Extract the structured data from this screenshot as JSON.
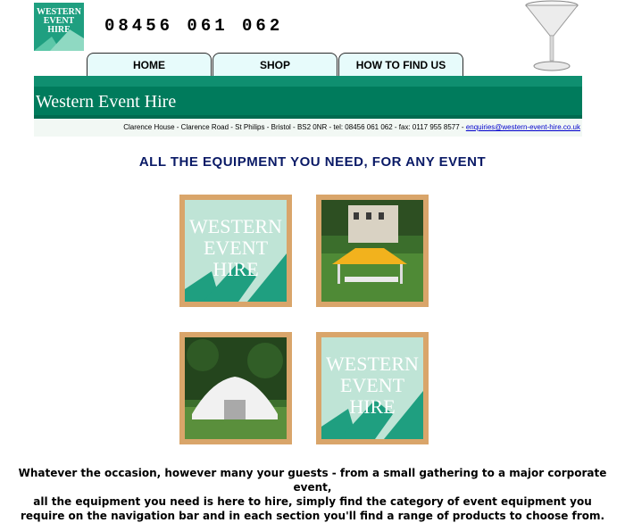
{
  "header": {
    "logo_text": [
      "WESTERN",
      "EVENT",
      "HIRE"
    ],
    "phone": "08456 061 062"
  },
  "nav": {
    "tabs": [
      {
        "label": "HOME"
      },
      {
        "label": "SHOP"
      },
      {
        "label": "HOW TO FIND US"
      }
    ]
  },
  "banner": {
    "brand": "Western Event Hire",
    "address": "Clarence House - Clarence Road - St Philips - Bristol - BS2 0NR - tel: 08456 061 062 - fax: 0117 955 8577 - ",
    "email": "enquiries@western-event-hire.co.uk"
  },
  "main": {
    "headline": "ALL THE EQUIPMENT YOU NEED, FOR ANY EVENT",
    "tile_logo_text": [
      "WESTERN",
      "EVENT",
      "HIRE"
    ],
    "paragraph": [
      "Whatever the occasion, however many your guests - from a small gathering to a major corporate event,",
      "all the equipment you need is here to hire, simply find the category of event equipment you",
      "require on the navigation bar and in each section you'll find a range of products to choose from."
    ]
  },
  "colors": {
    "brand_green": "#007b5c",
    "tile_frame": "#d9a56a",
    "headline": "#0a1a66"
  }
}
